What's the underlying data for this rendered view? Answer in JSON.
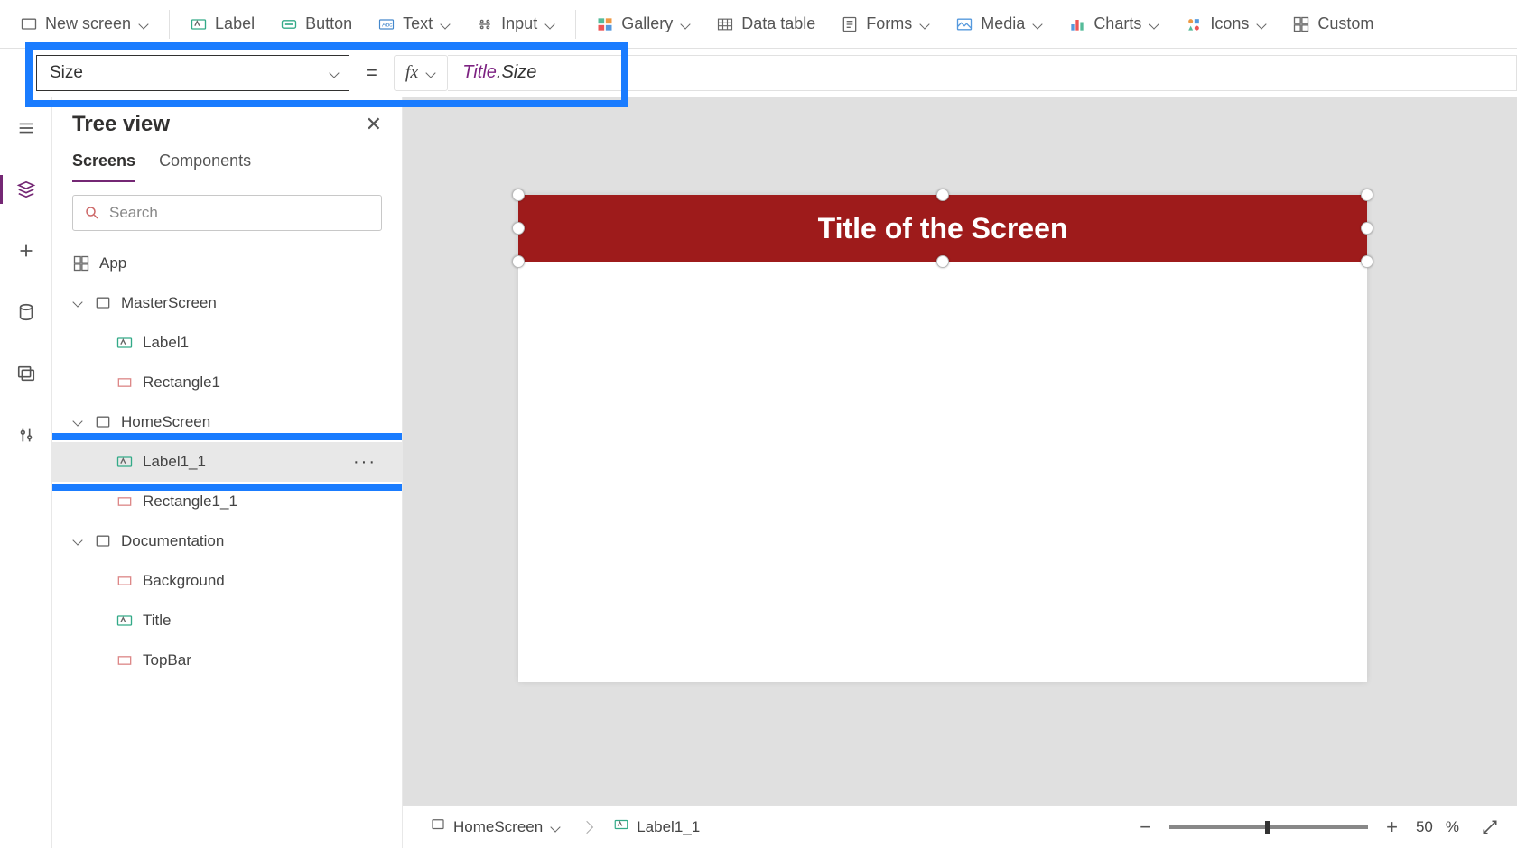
{
  "ribbon": {
    "new_screen": "New screen",
    "label": "Label",
    "button": "Button",
    "text": "Text",
    "input": "Input",
    "gallery": "Gallery",
    "data_table": "Data table",
    "forms": "Forms",
    "media": "Media",
    "charts": "Charts",
    "icons": "Icons",
    "custom": "Custom"
  },
  "formula": {
    "property": "Size",
    "fx": "fx",
    "obj": "Title",
    "dot": ".",
    "prop": "Size"
  },
  "tree": {
    "title": "Tree view",
    "tab_screens": "Screens",
    "tab_components": "Components",
    "search_placeholder": "Search",
    "nodes": {
      "app": "App",
      "master": "MasterScreen",
      "label1": "Label1",
      "rect1": "Rectangle1",
      "home": "HomeScreen",
      "label1_1": "Label1_1",
      "rect1_1": "Rectangle1_1",
      "doc": "Documentation",
      "background": "Background",
      "title": "Title",
      "topbar": "TopBar"
    }
  },
  "canvas": {
    "title_text": "Title of the Screen"
  },
  "status": {
    "crumb_screen": "HomeScreen",
    "crumb_control": "Label1_1",
    "zoom": "50",
    "zoom_pct": "%"
  }
}
